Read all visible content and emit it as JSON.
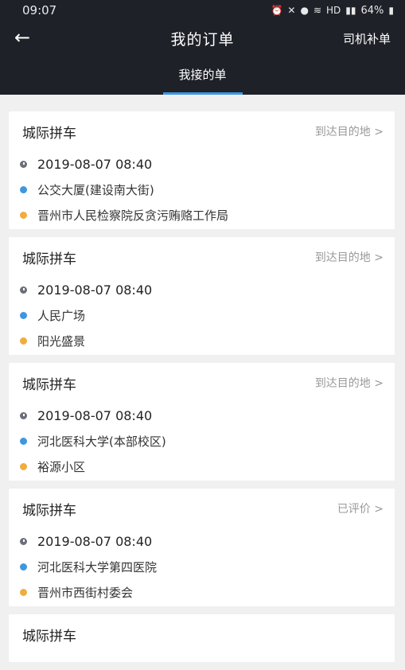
{
  "status_bar": {
    "time": "09:07",
    "icons": [
      "alarm-icon",
      "mute-icon",
      "location-icon",
      "wifi-icon",
      "signal-icon",
      "battery-icon"
    ],
    "hd": "HD",
    "battery": "64%"
  },
  "nav": {
    "back_icon": "←",
    "title": "我的订单",
    "right_action": "司机补单"
  },
  "tabs": [
    {
      "label": "我接的单",
      "active": true
    }
  ],
  "colors": {
    "header_bg": "#1f2129",
    "accent": "#3f96e0",
    "start_dot": "#3f96e0",
    "end_dot": "#f0ad3e"
  },
  "orders": [
    {
      "type": "城际拼车",
      "status": "到达目的地 >",
      "time": "2019-08-07 08:40",
      "from": "公交大厦(建设南大街)",
      "to": "晋州市人民检察院反贪污贿赂工作局"
    },
    {
      "type": "城际拼车",
      "status": "到达目的地 >",
      "time": "2019-08-07 08:40",
      "from": "人民广场",
      "to": "阳光盛景"
    },
    {
      "type": "城际拼车",
      "status": "到达目的地 >",
      "time": "2019-08-07 08:40",
      "from": "河北医科大学(本部校区)",
      "to": "裕源小区"
    },
    {
      "type": "城际拼车",
      "status": "已评价 >",
      "time": "2019-08-07 08:40",
      "from": "河北医科大学第四医院",
      "to": "晋州市西街村委会"
    },
    {
      "type": "城际拼车"
    }
  ]
}
